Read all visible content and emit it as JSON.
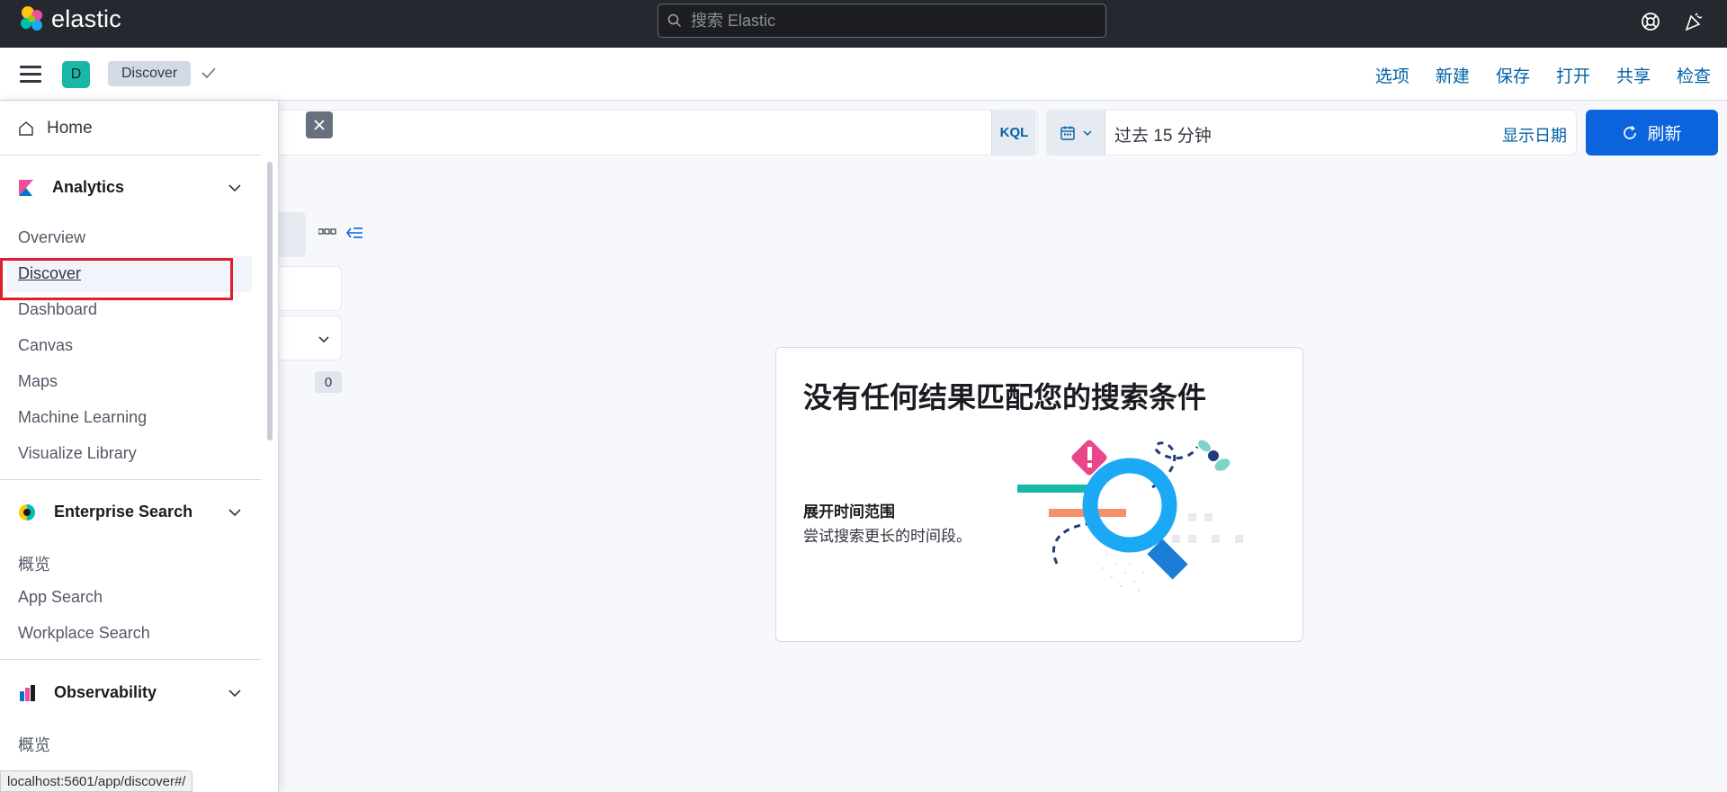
{
  "topbar": {
    "logo_text": "elastic",
    "search_placeholder": "搜索 Elastic"
  },
  "app_header": {
    "space_initial": "D",
    "breadcrumb": "Discover",
    "menu": [
      "选项",
      "新建",
      "保存",
      "打开",
      "共享",
      "检查"
    ]
  },
  "query_bar": {
    "language": "KQL",
    "time_range": "过去 15 分钟",
    "show_dates": "显示日期",
    "refresh": "刷新"
  },
  "sidebar": {
    "field_count": "0"
  },
  "nav": {
    "home": "Home",
    "groups": [
      {
        "label": "Analytics",
        "items": [
          "Overview",
          "Discover",
          "Dashboard",
          "Canvas",
          "Maps",
          "Machine Learning",
          "Visualize Library"
        ]
      },
      {
        "label": "Enterprise Search",
        "items": [
          "概览",
          "App Search",
          "Workplace Search"
        ]
      },
      {
        "label": "Observability",
        "items": [
          "概览"
        ]
      }
    ],
    "active_item": "Discover"
  },
  "empty_prompt": {
    "title": "没有任何结果匹配您的搜索条件",
    "subtitle": "展开时间范围",
    "description": "尝试搜索更长的时间段。"
  },
  "status_bar": {
    "url": "localhost:5601/app/discover#/"
  },
  "colors": {
    "header_bg": "#25282f",
    "link": "#0061a6",
    "primary_button": "#0b64dd",
    "highlight": "#e11e2b"
  }
}
